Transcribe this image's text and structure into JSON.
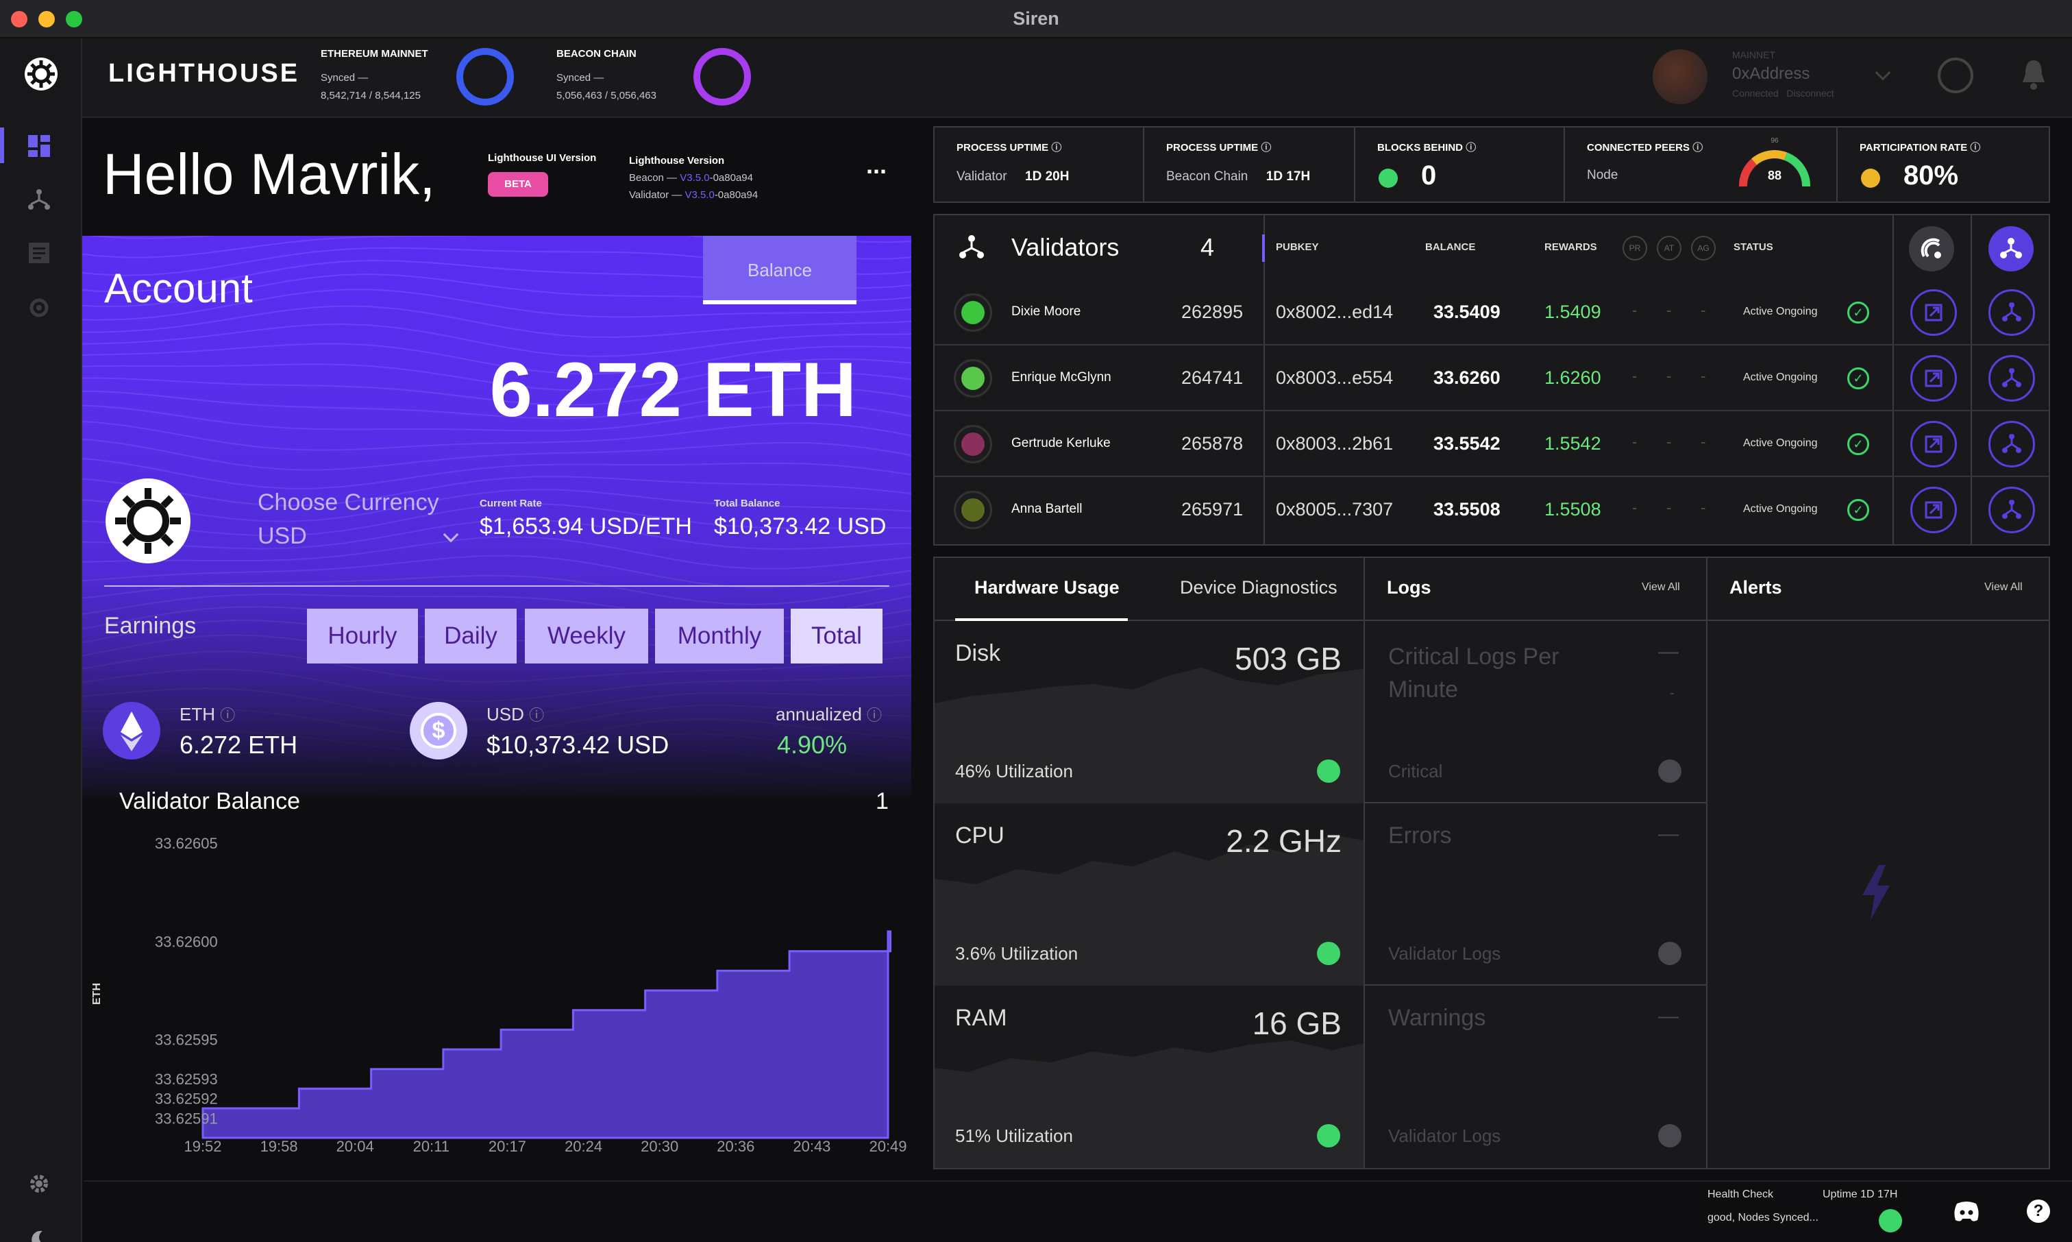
{
  "window": {
    "title": "Siren"
  },
  "app": {
    "logo": "LIGHTHOUSE"
  },
  "networks": [
    {
      "label": "ETHEREUM MAINNET",
      "status": "Synced —",
      "progress": "8,542,714 / 8,544,125",
      "ring_color": "#3b5bf0"
    },
    {
      "label": "BEACON CHAIN",
      "status": "Synced —",
      "progress": "5,056,463 / 5,056,463",
      "ring_color": "#a73cf0"
    }
  ],
  "account_header": {
    "network": "MAINNET",
    "address": "0xAddress",
    "connected": "Connected",
    "disconnect": "Disconnect"
  },
  "greeting": "Hello Mavrik,",
  "versions": {
    "ui_label": "Lighthouse UI Version",
    "ui_badge": "BETA",
    "lh_label": "Lighthouse Version",
    "beacon_prefix": "Beacon —",
    "beacon_version": "V3.5.0",
    "beacon_hash": "-0a80a94",
    "validator_prefix": "Validator —",
    "validator_version": "V3.5.0",
    "validator_hash": "-0a80a94",
    "more": "..."
  },
  "account": {
    "title": "Account",
    "tab": "Balance",
    "balance": "6.272 ETH",
    "currency_label": "Choose Currency",
    "currency_value": "USD",
    "rate_label": "Current Rate",
    "rate_value": "$1,653.94 USD/ETH",
    "total_label": "Total Balance",
    "total_value": "$10,373.42 USD",
    "earnings_label": "Earnings",
    "earnings_tabs": [
      "Hourly",
      "Daily",
      "Weekly",
      "Monthly",
      "Total"
    ],
    "eth_label": "ETH",
    "eth_value": "6.272 ETH",
    "usd_label": "USD",
    "usd_value": "$10,373.42 USD",
    "annualized_label": "annualized",
    "annualized_value": "4.90%"
  },
  "validator_chart": {
    "title": "Validator Balance",
    "count": "1",
    "ylabel": "ETH",
    "chart_data": {
      "type": "area",
      "x": [
        "19:52",
        "19:58",
        "20:04",
        "20:11",
        "20:17",
        "20:24",
        "20:30",
        "20:36",
        "20:43",
        "20:49"
      ],
      "ytick_labels": [
        "33.62605",
        "33.62600",
        "33.62595",
        "33.62593",
        "33.62592",
        "33.62591"
      ],
      "ytick_values": [
        33.62605,
        33.626,
        33.62595,
        33.62593,
        33.62592,
        33.62591
      ],
      "ylim": [
        33.6259,
        33.62605
      ],
      "steps": [
        {
          "x": 19.87,
          "y": 33.625915
        },
        {
          "x": 20.0,
          "y": 33.625925
        },
        {
          "x": 20.1,
          "y": 33.625935
        },
        {
          "x": 20.2,
          "y": 33.625945
        },
        {
          "x": 20.28,
          "y": 33.625955
        },
        {
          "x": 20.38,
          "y": 33.625965
        },
        {
          "x": 20.48,
          "y": 33.625975
        },
        {
          "x": 20.58,
          "y": 33.625985
        },
        {
          "x": 20.68,
          "y": 33.625995
        },
        {
          "x": 20.82,
          "y": 33.626005
        }
      ],
      "color": "#5b3fd9",
      "grid": false
    }
  },
  "stats": [
    {
      "label": "PROCESS UPTIME",
      "sub": "Validator",
      "value": "1D 20H"
    },
    {
      "label": "PROCESS UPTIME",
      "sub": "Beacon Chain",
      "value": "1D 17H"
    },
    {
      "label": "BLOCKS BEHIND",
      "value": "0"
    },
    {
      "label": "CONNECTED PEERS",
      "sub": "Node",
      "gauge_value": "88",
      "gauge_max": "96"
    },
    {
      "label": "PARTICIPATION RATE",
      "value": "80%"
    }
  ],
  "validators": {
    "title": "Validators",
    "count": "4",
    "columns": {
      "pubkey": "PUBKEY",
      "balance": "BALANCE",
      "rewards": "REWARDS",
      "pr": "PR",
      "at": "AT",
      "ag": "AG",
      "status": "STATUS"
    },
    "rows": [
      {
        "name": "Dixie Moore",
        "index": "262895",
        "pubkey": "0x8002...ed14",
        "balance": "33.5409",
        "rewards": "1.5409",
        "pr": "-",
        "at": "-",
        "ag": "-",
        "status": "Active Ongoing",
        "avatar_color": "#3ec53e"
      },
      {
        "name": "Enrique McGlynn",
        "index": "264741",
        "pubkey": "0x8003...e554",
        "balance": "33.6260",
        "rewards": "1.6260",
        "pr": "-",
        "at": "-",
        "ag": "-",
        "status": "Active Ongoing",
        "avatar_color": "#5ac84a"
      },
      {
        "name": "Gertrude Kerluke",
        "index": "265878",
        "pubkey": "0x8003...2b61",
        "balance": "33.5542",
        "rewards": "1.5542",
        "pr": "-",
        "at": "-",
        "ag": "-",
        "status": "Active Ongoing",
        "avatar_color": "#8a2f5e"
      },
      {
        "name": "Anna Bartell",
        "index": "265971",
        "pubkey": "0x8005...7307",
        "balance": "33.5508",
        "rewards": "1.5508",
        "pr": "-",
        "at": "-",
        "ag": "-",
        "status": "Active Ongoing",
        "avatar_color": "#5a6a1e"
      }
    ]
  },
  "hardware": {
    "tabs": [
      "Hardware Usage",
      "Device Diagnostics"
    ],
    "items": [
      {
        "label": "Disk",
        "value": "503 GB",
        "util": "46% Utilization"
      },
      {
        "label": "CPU",
        "value": "2.2 GHz",
        "util": "3.6% Utilization"
      },
      {
        "label": "RAM",
        "value": "16 GB",
        "util": "51% Utilization"
      }
    ]
  },
  "logs": {
    "title": "Logs",
    "view_all": "View All",
    "items": [
      {
        "label": "Critical Logs Per Minute",
        "value": "—",
        "value2": "-",
        "sub": "Critical"
      },
      {
        "label": "Errors",
        "value": "—",
        "sub": "Validator Logs"
      },
      {
        "label": "Warnings",
        "value": "—",
        "sub": "Validator Logs"
      }
    ]
  },
  "alerts": {
    "title": "Alerts",
    "view_all": "View All"
  },
  "footer": {
    "health_label": "Health Check",
    "health_value": "good, Nodes Synced...",
    "uptime": "Uptime 1D 17H"
  }
}
